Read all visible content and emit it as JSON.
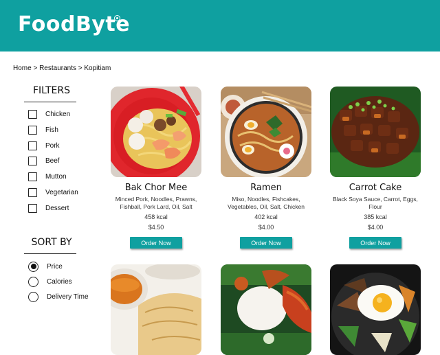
{
  "header": {
    "logo_text": "FoodByte",
    "accent_color": "#0fa0a0"
  },
  "breadcrumb": "Home > Restaurants > Kopitiam",
  "filters": {
    "title": "FILTERS",
    "options": [
      "Chicken",
      "Fish",
      "Pork",
      "Beef",
      "Mutton",
      "Vegetarian",
      "Dessert"
    ]
  },
  "sort": {
    "title": "SORT BY",
    "options": [
      "Price",
      "Calories",
      "Delivery Time"
    ],
    "selected": "Price"
  },
  "items": [
    {
      "name": "Bak Chor Mee",
      "description": "Minced Pork, Noodles, Prawns, Fishball, Pork Lard, Oil, Salt",
      "kcal": "458 kcal",
      "price": "$4.50",
      "button": "Order Now",
      "image": "bak-chor-mee-photo"
    },
    {
      "name": "Ramen",
      "description": "Miso, Noodles, Fishcakes, Vegetables, Oil, Salt, Chicken",
      "kcal": "402 kcal",
      "price": "$4.00",
      "button": "Order Now",
      "image": "ramen-photo"
    },
    {
      "name": "Carrot Cake",
      "description": "Black Soya Sauce, Carrot, Eggs, Flour",
      "kcal": "385 kcal",
      "price": "$4.00",
      "button": "Order Now",
      "image": "carrot-cake-photo"
    },
    {
      "image": "prata-curry-photo"
    },
    {
      "image": "nasi-lemak-photo"
    },
    {
      "image": "bibimbap-photo"
    }
  ]
}
